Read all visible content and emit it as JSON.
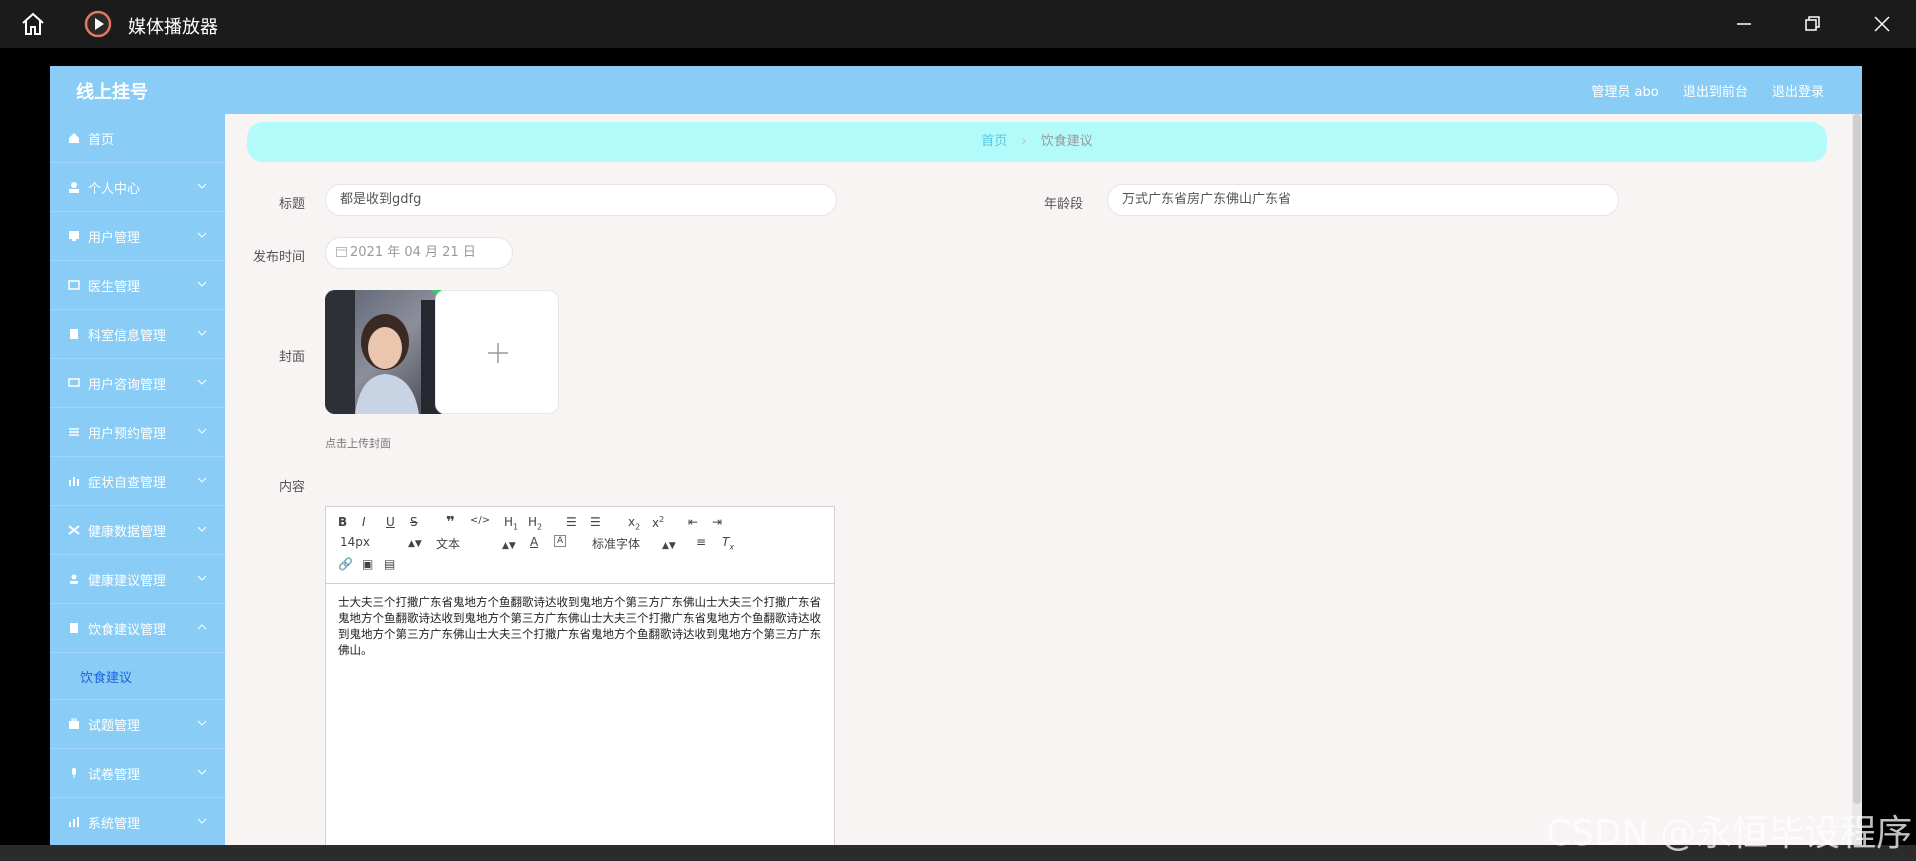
{
  "window": {
    "title": "媒体播放器",
    "icons": {
      "home": "home-icon",
      "app": "play-icon",
      "minimize": "minimize-icon",
      "restore": "restore-icon",
      "close": "close-icon"
    }
  },
  "header": {
    "brand": "线上挂号",
    "links": [
      "管理员 abo",
      "退出到前台",
      "退出登录"
    ]
  },
  "sidebar": {
    "items": [
      {
        "label": "首页",
        "icon": "home-icon",
        "expandable": false
      },
      {
        "label": "个人中心",
        "icon": "user-icon",
        "expandable": true
      },
      {
        "label": "用户管理",
        "icon": "monitor-icon",
        "expandable": true
      },
      {
        "label": "医生管理",
        "icon": "card-icon",
        "expandable": true
      },
      {
        "label": "科室信息管理",
        "icon": "clipboard-icon",
        "expandable": true
      },
      {
        "label": "用户咨询管理",
        "icon": "message-icon",
        "expandable": true
      },
      {
        "label": "用户预约管理",
        "icon": "list-icon",
        "expandable": true
      },
      {
        "label": "症状自查管理",
        "icon": "chart-icon",
        "expandable": true
      },
      {
        "label": "健康数据管理",
        "icon": "data-icon",
        "expandable": true
      },
      {
        "label": "健康建议管理",
        "icon": "person-icon",
        "expandable": true
      },
      {
        "label": "饮食建议管理",
        "icon": "clipboard-icon",
        "expandable": true,
        "expanded": true
      }
    ],
    "submenu": [
      "饮食建议"
    ],
    "items_after": [
      {
        "label": "试题管理",
        "icon": "briefcase-icon"
      },
      {
        "label": "试卷管理",
        "icon": "mic-icon"
      },
      {
        "label": "系统管理",
        "icon": "bar-icon"
      }
    ]
  },
  "breadcrumb": {
    "home": "首页",
    "separator": "›",
    "current": "饮食建议"
  },
  "form": {
    "title_label": "标题",
    "title_value": "都是收到gdfg",
    "age_label": "年龄段",
    "age_value": "万式广东省房广东佛山广东省",
    "date_label": "发布时间",
    "date_value": "2021 年 04 月 21 日",
    "cover_label": "封面",
    "cover_hint": "点击上传封面",
    "content_label": "内容"
  },
  "editor": {
    "font_size": "14px",
    "text_type": "文本",
    "font_family": "标准字体",
    "content": "士大夫三个打撒广东省鬼地方个鱼翻歌诗达收到鬼地方个第三方广东佛山士大夫三个打撒广东省鬼地方个鱼翻歌诗达收到鬼地方个第三方广东佛山士大夫三个打撒广东省鬼地方个鱼翻歌诗达收到鬼地方个第三方广东佛山士大夫三个打撒广东省鬼地方个鱼翻歌诗达收到鬼地方个第三方广东佛山。"
  },
  "watermark": "CSDN @永恒毕设程序"
}
